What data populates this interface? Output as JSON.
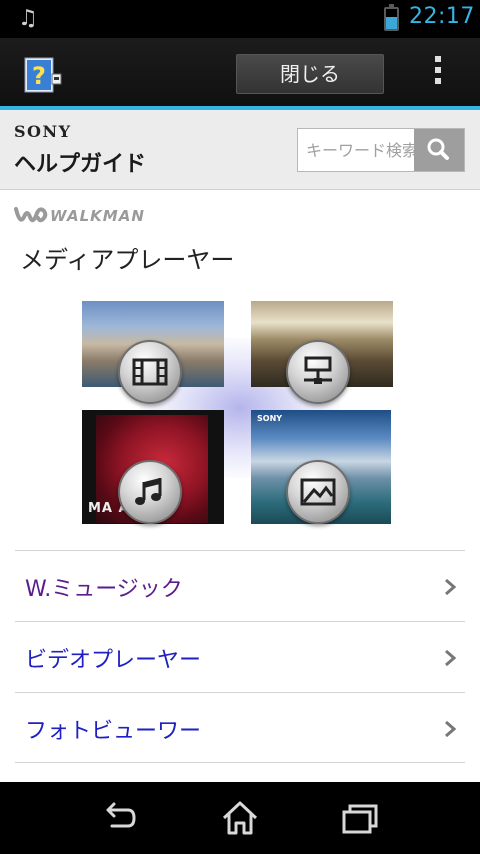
{
  "status_bar": {
    "notification_icon": "music-note-icon",
    "battery_level": 0.6,
    "time": "22:17"
  },
  "action_bar": {
    "app_icon": "help-guide-icon",
    "close_label": "閉じる",
    "overflow_icon": "overflow-menu-icon"
  },
  "header": {
    "brand": "SONY",
    "title": "ヘルプガイド",
    "search": {
      "placeholder": "キーワード検索",
      "button_icon": "search-icon"
    }
  },
  "content": {
    "logo_text": "WALKMAN",
    "page_title": "メディアプレーヤー",
    "tiles": [
      {
        "icon": "video-film-icon"
      },
      {
        "icon": "network-icon"
      },
      {
        "icon": "music-note-icon",
        "cover_text": "MA         AKA"
      },
      {
        "icon": "photo-icon",
        "cover_brand": "SONY"
      }
    ],
    "menu": [
      {
        "label": "W.ミュージック",
        "visited": true
      },
      {
        "label": "ビデオプレーヤー",
        "visited": false
      },
      {
        "label": "フォトビューワー",
        "visited": false
      }
    ]
  },
  "nav_bar": {
    "back_icon": "back-icon",
    "home_icon": "home-icon",
    "recent_icon": "recent-apps-icon"
  },
  "colors": {
    "accent": "#33b5e5",
    "visited_link": "#5a1e8c",
    "link": "#1f1fc4"
  }
}
